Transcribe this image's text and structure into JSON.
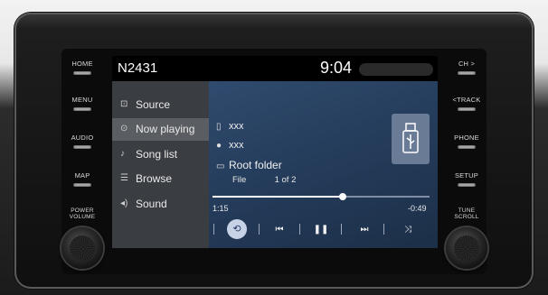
{
  "hardware": {
    "left_buttons": [
      "HOME",
      "MENU",
      "AUDIO",
      "MAP",
      "POWER\nVOLUME"
    ],
    "right_buttons": [
      "CH >",
      "<TRACK",
      "PHONE",
      "SETUP",
      "TUNE\nSCROLL"
    ]
  },
  "status_bar": {
    "station": "N2431",
    "clock": "9:04"
  },
  "sidebar": {
    "items": [
      {
        "label": "Source",
        "icon": "source-icon",
        "selected": false
      },
      {
        "label": "Now playing",
        "icon": "play-circle-icon",
        "selected": true
      },
      {
        "label": "Song list",
        "icon": "song-list-icon",
        "selected": false
      },
      {
        "label": "Browse",
        "icon": "browse-icon",
        "selected": false
      },
      {
        "label": "Sound",
        "icon": "speaker-icon",
        "selected": false
      }
    ]
  },
  "now_playing": {
    "title": "xxx",
    "artist": "xxx",
    "folder": "Root folder",
    "file_label": "File",
    "file_position": "1 of 2",
    "elapsed": "1:15",
    "remaining": "-0:49",
    "progress": 0.6,
    "source_icon": "usb-icon"
  },
  "controls": [
    "repeat-icon",
    "previous-track-icon",
    "pause-icon",
    "next-track-icon",
    "shuffle-icon"
  ]
}
